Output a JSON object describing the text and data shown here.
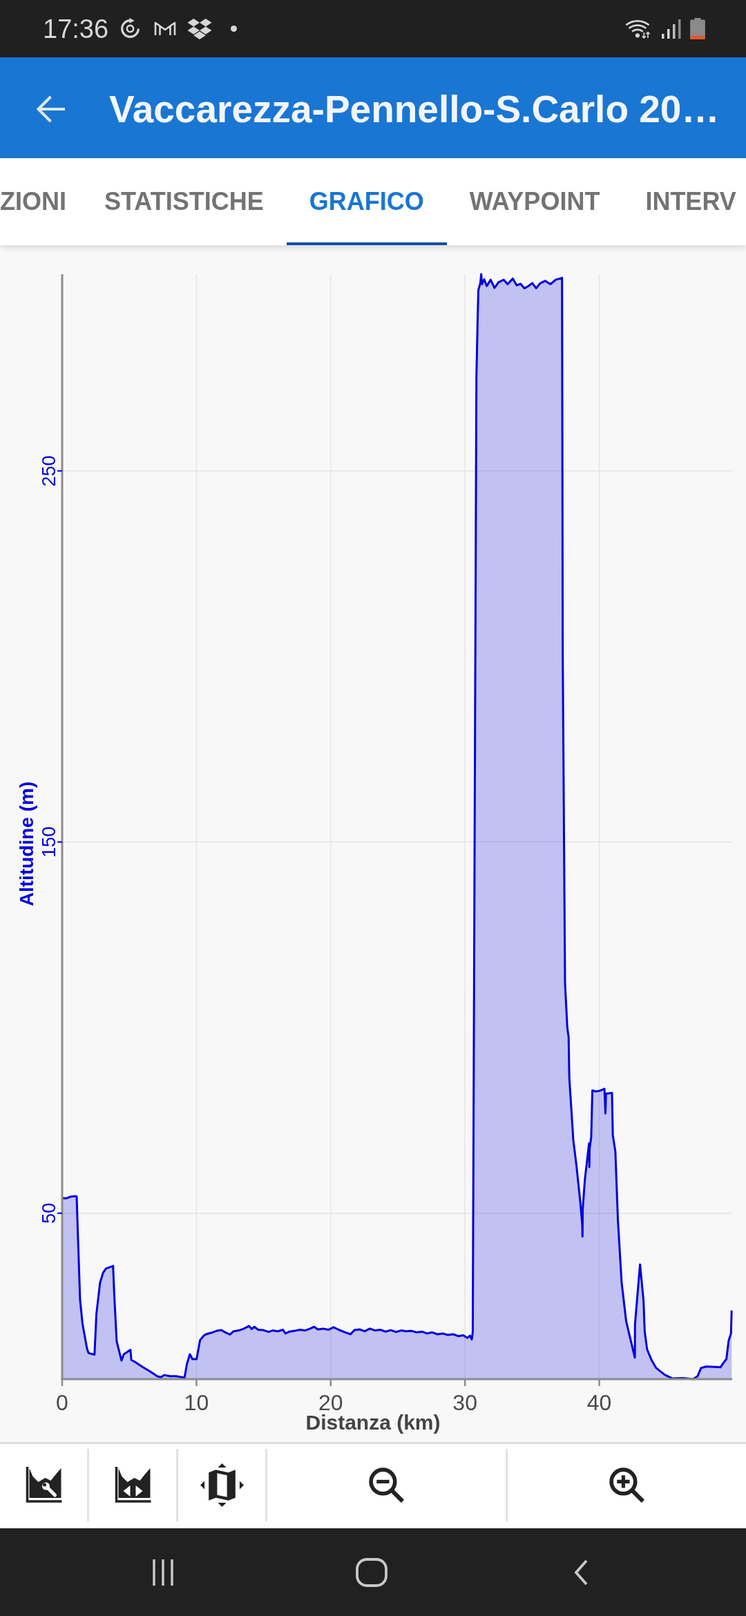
{
  "status_bar": {
    "time": "17:36"
  },
  "app_bar": {
    "title": "Vaccarezza-Pennello-S.Carlo 20…"
  },
  "tabs": [
    {
      "label": "ZIONI",
      "selected": false
    },
    {
      "label": "STATISTICHE",
      "selected": false
    },
    {
      "label": "GRAFICO",
      "selected": true
    },
    {
      "label": "WAYPOINT",
      "selected": false
    },
    {
      "label": "INTERV",
      "selected": false
    }
  ],
  "chart": {
    "chart_data": {
      "type": "area",
      "xlabel": "Distanza (km)",
      "ylabel": "Altitudine (m)",
      "xlim": [
        0,
        49.9
      ],
      "ylim": [
        5.3,
        303
      ],
      "xticks": [
        0,
        10,
        20,
        30,
        40
      ],
      "yticks": [
        50,
        150,
        250
      ],
      "grid": true,
      "x": [
        0,
        0.29,
        0.58,
        0.97,
        1.08,
        1.18,
        1.33,
        1.51,
        1.85,
        1.97,
        2.41,
        2.55,
        2.82,
        3.05,
        3.26,
        3.79,
        3.89,
        4.06,
        4.42,
        4.59,
        5.09,
        5.15,
        5.39,
        6.02,
        6.54,
        7.08,
        7.35,
        7.61,
        8.03,
        8.49,
        9.11,
        9.29,
        9.51,
        9.7,
        10.01,
        10.27,
        10.54,
        10.72,
        11.12,
        11.51,
        11.87,
        12.09,
        12.49,
        12.77,
        13.15,
        13.54,
        13.91,
        14.12,
        14.31,
        14.6,
        14.99,
        15.38,
        15.67,
        16.05,
        16.44,
        16.63,
        16.92,
        17.31,
        17.7,
        18.08,
        18.47,
        18.76,
        19.05,
        19.44,
        19.83,
        20.21,
        20.6,
        20.99,
        21.47,
        21.76,
        22.15,
        22.53,
        22.92,
        23.31,
        23.69,
        24.08,
        24.47,
        24.85,
        25.24,
        25.63,
        26.01,
        26.4,
        26.79,
        27.18,
        27.56,
        27.95,
        28.34,
        28.72,
        29.11,
        29.5,
        29.88,
        30.17,
        30.37,
        30.51,
        30.58,
        30.85,
        30.95,
        31.0,
        31.14,
        31.21,
        31.27,
        31.43,
        31.62,
        31.91,
        32.2,
        32.49,
        32.88,
        33.17,
        33.56,
        33.85,
        34.14,
        34.43,
        34.72,
        35.01,
        35.3,
        35.59,
        35.98,
        36.36,
        36.75,
        37.23,
        37.28,
        37.45,
        37.62,
        37.72,
        37.77,
        38.07,
        38.3,
        38.59,
        38.73,
        38.75,
        38.77,
        38.93,
        39.24,
        39.26,
        39.28,
        39.4,
        39.49,
        39.75,
        40.04,
        40.39,
        40.46,
        40.5,
        40.95,
        41.01,
        41.2,
        41.39,
        41.67,
        42.01,
        42.65,
        42.66,
        43.04,
        43.3,
        43.38,
        43.56,
        43.91,
        44.24,
        44.87,
        45.43,
        46.23,
        47.0,
        47.33,
        47.58,
        47.97,
        48.55,
        49.03,
        49.23,
        49.47,
        49.64,
        49.81,
        49.86
      ],
      "series": [
        {
          "color": "#0000dd",
          "values": [
            54.1,
            54.0,
            54.4,
            54.6,
            54.5,
            43.5,
            26.7,
            20.3,
            13.5,
            12.3,
            11.9,
            22.9,
            31.2,
            34.0,
            35.1,
            35.8,
            27.4,
            15.5,
            10.3,
            12.0,
            13.2,
            10.5,
            10.0,
            8.5,
            7.4,
            6.1,
            5.8,
            6.4,
            6.1,
            6.1,
            5.7,
            9.4,
            12.0,
            10.7,
            10.7,
            15.8,
            17.0,
            17.4,
            17.8,
            18.3,
            18.5,
            18.0,
            17.3,
            18.2,
            18.4,
            18.9,
            19.6,
            18.8,
            19.4,
            18.6,
            18.5,
            18.0,
            18.4,
            18.2,
            18.6,
            17.6,
            18.1,
            18.3,
            18.6,
            18.4,
            18.9,
            19.4,
            18.7,
            18.9,
            18.6,
            19.3,
            18.6,
            18.0,
            17.4,
            18.5,
            18.7,
            18.2,
            18.9,
            18.4,
            18.6,
            18.1,
            18.5,
            18.0,
            18.4,
            18.2,
            18.3,
            17.9,
            18.1,
            17.6,
            17.9,
            17.4,
            17.6,
            17.2,
            17.4,
            16.9,
            17.1,
            16.4,
            17.0,
            16.0,
            18.0,
            275,
            292,
            298.8,
            300.5,
            303,
            300.3,
            301.6,
            299.8,
            301.5,
            299.3,
            300.8,
            301.5,
            300.3,
            301.8,
            300.0,
            300.4,
            299.2,
            299.8,
            300.6,
            299.2,
            300.5,
            301.2,
            300.3,
            301.5,
            302.0,
            200,
            112,
            100,
            97.5,
            86.5,
            69.7,
            62.9,
            53.0,
            47.0,
            43.7,
            51.1,
            59.2,
            68.8,
            62.4,
            67.5,
            70.4,
            83.1,
            82.8,
            83.0,
            83.5,
            76.9,
            82.2,
            82.4,
            71.0,
            66.6,
            48.0,
            31.2,
            20.8,
            11.1,
            20.1,
            36.2,
            26.3,
            18.2,
            13.3,
            10.3,
            8.3,
            6.5,
            5.5,
            5.6,
            5.3,
            6.1,
            8.3,
            8.7,
            8.6,
            8.5,
            9.6,
            10.7,
            15.7,
            17.6,
            23.8
          ]
        }
      ]
    }
  }
}
